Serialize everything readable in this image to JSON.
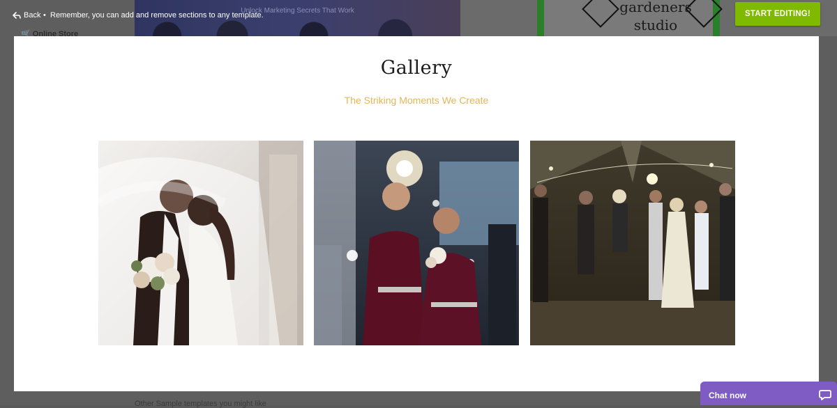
{
  "topbar": {
    "back_label": "Back",
    "separator": "•",
    "message": "Remember, you can add and remove sections to any template.",
    "start_button": "START EDITING!"
  },
  "background": {
    "banner_text": "Unlock Marketing Secrets That Work",
    "sign_line1": "gardeners",
    "sign_line2": "studio",
    "store_label": "Online Store",
    "bottom_text": "Other Sample templates you might like"
  },
  "gallery": {
    "title": "Gallery",
    "subtitle": "The Striking Moments We Create",
    "photos": [
      {
        "icon": "wedding-couple-photo"
      },
      {
        "icon": "bridesmaids-sparklers-photo"
      },
      {
        "icon": "dance-tent-party-photo"
      }
    ]
  },
  "chat": {
    "label": "Chat now",
    "icon": "chat-bubble-icon"
  },
  "colors": {
    "accent_green": "#7fba00",
    "subtitle_gold": "#e3b65a",
    "chat_purple": "#7e5cc4"
  }
}
